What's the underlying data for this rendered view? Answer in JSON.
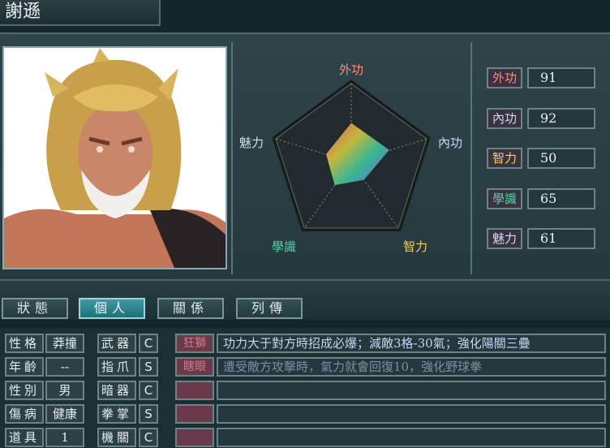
{
  "character": {
    "name": "謝遜"
  },
  "radar": {
    "axes": [
      "外功",
      "內功",
      "智力",
      "學識",
      "魅力"
    ],
    "axis_colors": [
      "#ff8a80",
      "#c8d8f0",
      "#f0d060",
      "#5ad0a8",
      "#c8e0f0"
    ]
  },
  "stats": [
    {
      "label": "外功",
      "value": "91",
      "color": "#ff8a80"
    },
    {
      "label": "內功",
      "value": "92",
      "color": "#c8d8f0"
    },
    {
      "label": "智力",
      "value": "50",
      "color": "#f0d060"
    },
    {
      "label": "學識",
      "value": "65",
      "color": "#5ad0a8"
    },
    {
      "label": "魅力",
      "value": "61",
      "color": "#c8e0f0"
    }
  ],
  "tabs": [
    {
      "label": "狀態",
      "active": false
    },
    {
      "label": "個人",
      "active": true
    },
    {
      "label": "關係",
      "active": false
    },
    {
      "label": "列傳",
      "active": false
    }
  ],
  "profile": [
    {
      "label": "性格",
      "value": "莽撞"
    },
    {
      "label": "年齡",
      "value": "--"
    },
    {
      "label": "性別",
      "value": "男"
    },
    {
      "label": "傷病",
      "value": "健康"
    },
    {
      "label": "道具",
      "value": "1"
    }
  ],
  "weapons": [
    {
      "label": "武器",
      "grade": "C"
    },
    {
      "label": "指爪",
      "grade": "S"
    },
    {
      "label": "暗器",
      "grade": "C"
    },
    {
      "label": "拳掌",
      "grade": "S"
    },
    {
      "label": "機關",
      "grade": "C"
    }
  ],
  "traits": [
    {
      "tag": "狂獅",
      "desc": "功力大于對方時招成必爆；減敵3格-30氣；強化陽關三疊"
    },
    {
      "tag": "瞎眼",
      "desc": "遭受敵方攻擊時，氣力就會回復10，強化野球拳"
    },
    {
      "tag": "",
      "desc": ""
    },
    {
      "tag": "",
      "desc": ""
    },
    {
      "tag": "",
      "desc": ""
    }
  ]
}
